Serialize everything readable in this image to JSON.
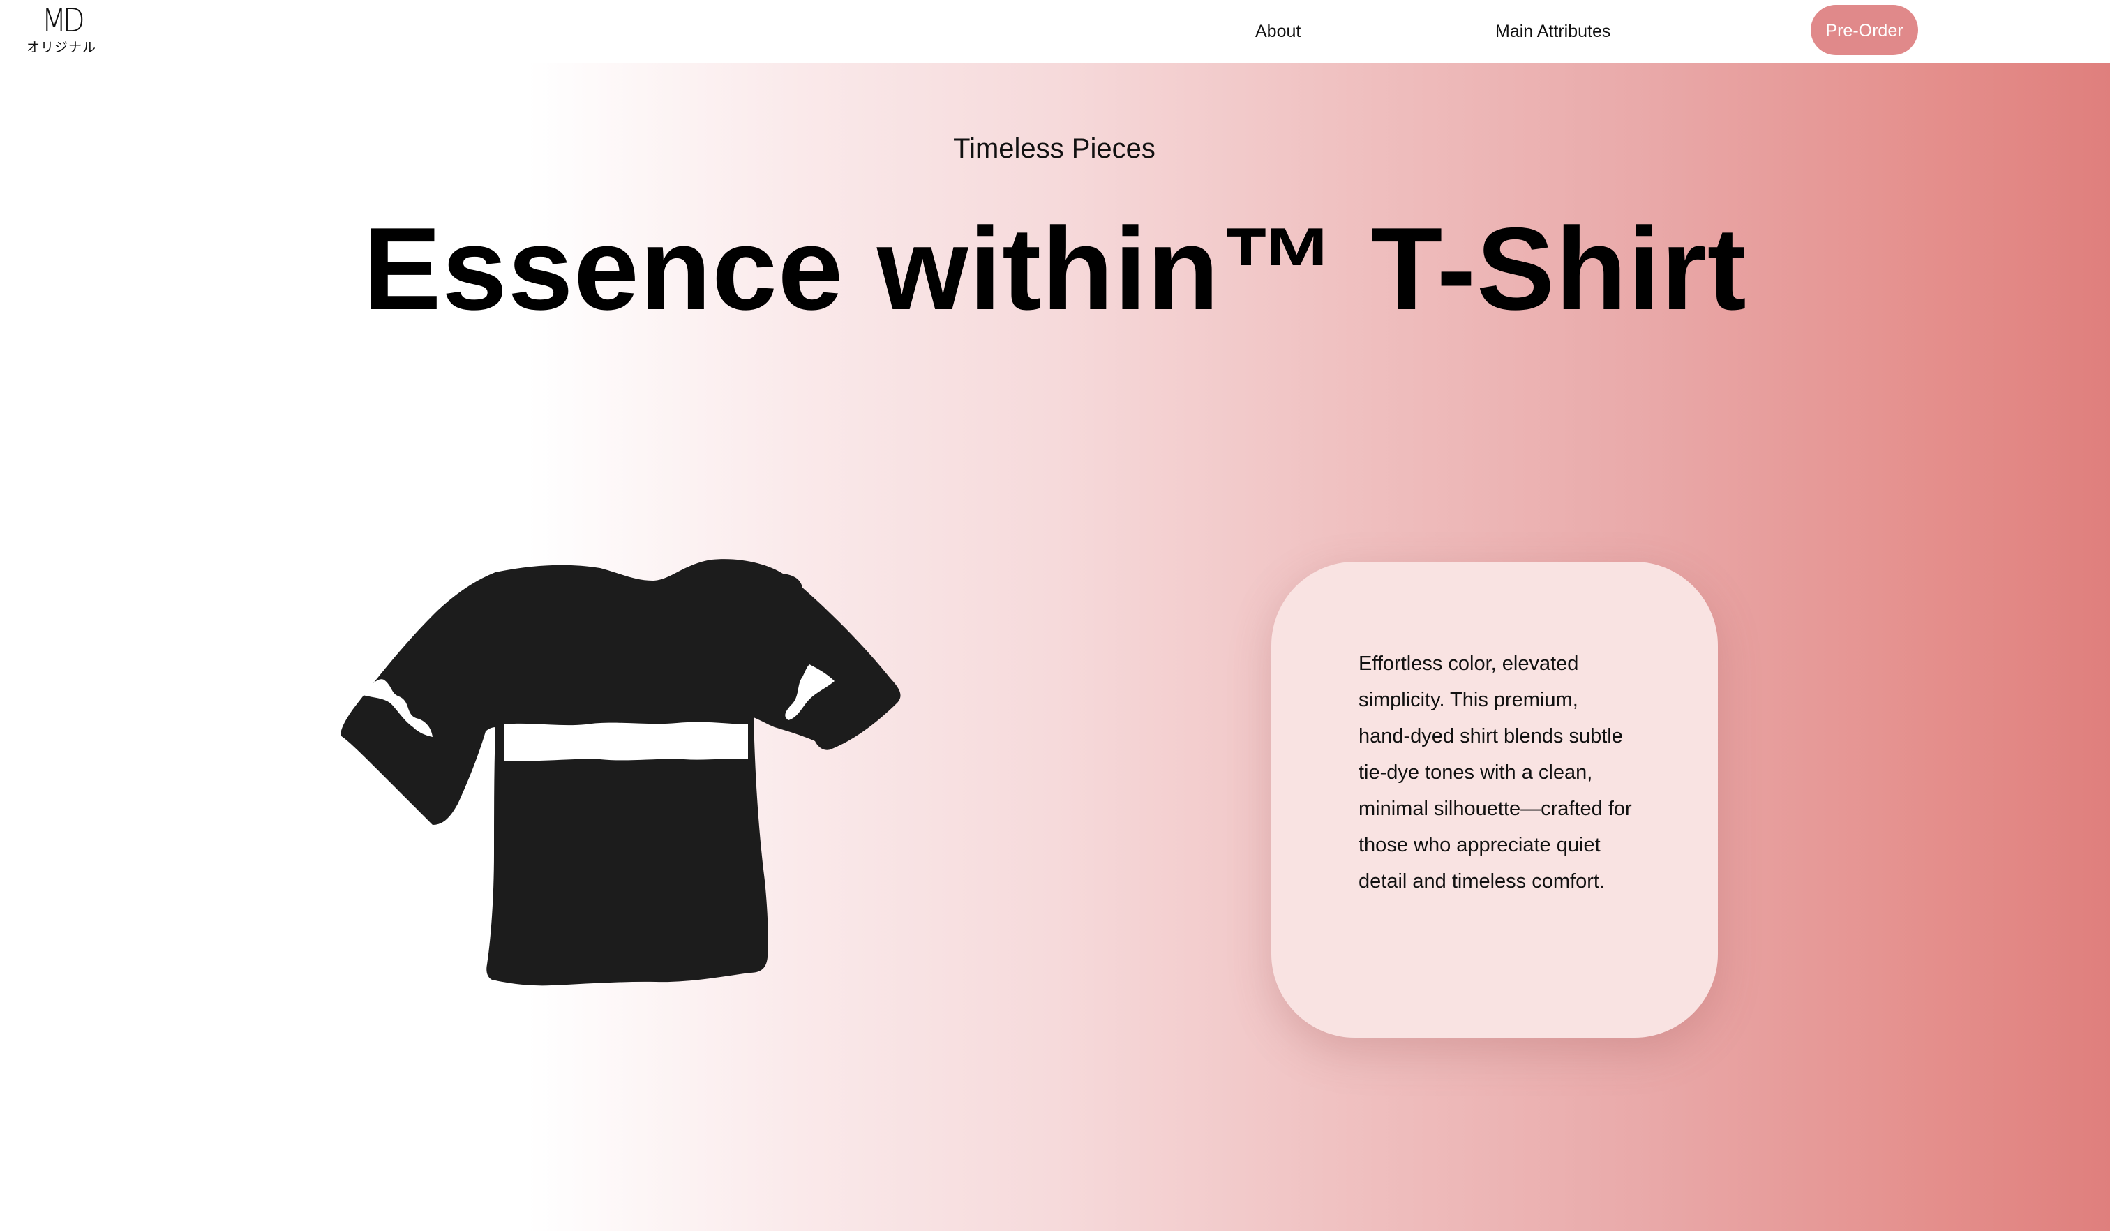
{
  "header": {
    "logo": {
      "mark": "MD",
      "subtitle": "オリジナル"
    },
    "nav": {
      "about": "About",
      "main_attributes": "Main Attributes"
    },
    "cta": "Pre-Order"
  },
  "hero": {
    "eyebrow": "Timeless Pieces",
    "title": "Essence within™ T-Shirt",
    "description": "Effortless color, elevated simplicity. This premium, hand-dyed shirt blends subtle tie-dye tones with a clean, minimal silhouette—crafted for those who appreciate quiet detail and timeless comfort.",
    "image_icon": "tshirt-silhouette-icon"
  },
  "colors": {
    "accent": "#e0898a",
    "gradient_end": "#df7f7d",
    "card_bg": "#f9e3e2",
    "shirt": "#1c1c1c"
  }
}
